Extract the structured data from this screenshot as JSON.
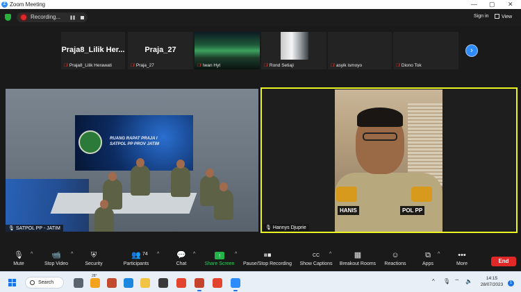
{
  "window": {
    "title": "Zoom Meeting",
    "logo": "Z",
    "controls": {
      "minimize": "—",
      "maximize": "▢",
      "close": "✕"
    }
  },
  "topbar": {
    "recording_label": "Recording...",
    "sign_in": "Sign in",
    "view": "View"
  },
  "participant_strip": [
    {
      "big_name": "Praja8_Lilik Her...",
      "name": "Praja8_Lilik Herawati",
      "video": "none"
    },
    {
      "big_name": "Praja_27",
      "name": "Praja_27",
      "video": "none"
    },
    {
      "big_name": "",
      "name": "Iwan Hyt",
      "video": "aurora"
    },
    {
      "big_name": "",
      "name": "Rond Setiaji",
      "video": "photo"
    },
    {
      "big_name": "",
      "name": "asyik ismoyo",
      "video": "none"
    },
    {
      "big_name": "",
      "name": "Diono Tok",
      "video": "none"
    }
  ],
  "main_videos": {
    "left": {
      "name": "SATPOL PP - JATIM",
      "screen_line1": "RUANG RAPAT PRAJA I",
      "screen_line2": "SATPOL PP PROV JATIM"
    },
    "right": {
      "name": "Hannys Djuprie",
      "uniform_name": "HANIS",
      "uniform_unit": "POL PP",
      "active_speaker_color": "#ecf51f"
    }
  },
  "toolbar": {
    "mute": "Mute",
    "stop_video": "Stop Video",
    "security": "Security",
    "participants": "Participants",
    "participants_count": "74",
    "chat": "Chat",
    "share_screen": "Share Screen",
    "pause_stop_recording": "Pause/Stop Recording",
    "show_captions": "Show Captions",
    "breakout_rooms": "Breakout Rooms",
    "reactions": "Reactions",
    "apps": "Apps",
    "more": "More",
    "end": "End"
  },
  "taskbar": {
    "search": "Search",
    "weather_temp": "28°",
    "time": "14:15",
    "date": "28/07/2023",
    "notification_count": "1"
  },
  "colors": {
    "zoom_blue": "#2d8cff",
    "end_red": "#e02828",
    "share_green": "#23b54a"
  }
}
